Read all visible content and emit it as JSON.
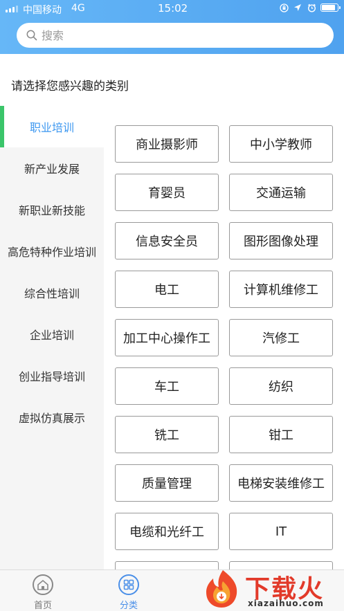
{
  "status_bar": {
    "carrier": "中国移动",
    "network": "4G",
    "time": "15:02",
    "battery_level": 0.9
  },
  "search": {
    "placeholder": "搜索"
  },
  "prompt": "请选择您感兴趣的类别",
  "menu": {
    "items": [
      {
        "label": "职业培训",
        "active": true
      },
      {
        "label": "新产业发展",
        "active": false
      },
      {
        "label": "新职业新技能",
        "active": false
      },
      {
        "label": "高危特种作业培训",
        "active": false
      },
      {
        "label": "综合性培训",
        "active": false
      },
      {
        "label": "企业培训",
        "active": false
      },
      {
        "label": "创业指导培训",
        "active": false
      },
      {
        "label": "虚拟仿真展示",
        "active": false
      }
    ]
  },
  "categories": [
    "商业摄影师",
    "中小学教师",
    "育婴员",
    "交通运输",
    "信息安全员",
    "图形图像处理",
    "电工",
    "计算机维修工",
    "加工中心操作工",
    "汽修工",
    "车工",
    "纺织",
    "铣工",
    "钳工",
    "质量管理",
    "电梯安装维修工",
    "电缆和光纤工",
    "IT",
    "",
    ""
  ],
  "tabbar": {
    "tabs": [
      {
        "label": "首页",
        "icon": "home-icon",
        "active": false
      },
      {
        "label": "分类",
        "icon": "category-icon",
        "active": true
      }
    ]
  },
  "watermark": {
    "text": "下载火",
    "url": "xiazaihuo.com"
  },
  "colors": {
    "accent": "#3c97f0",
    "active_indicator": "#3bc56a",
    "header_start": "#66b7f7",
    "header_end": "#4fa2ef"
  }
}
